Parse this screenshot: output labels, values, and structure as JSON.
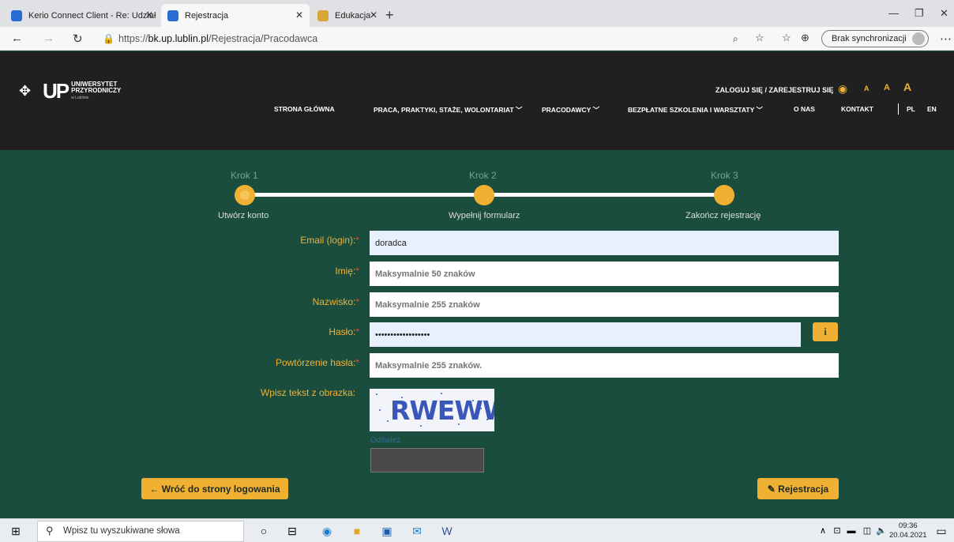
{
  "browser": {
    "tabs": [
      {
        "label": "Kerio Connect Client - Re: Udział",
        "color": "#2a6bd1"
      },
      {
        "label": "Rejestracja",
        "color": "#2a6bd1"
      },
      {
        "label": "Edukacja",
        "color": "#d9a63a"
      }
    ],
    "url_prefix": "https://",
    "url_domain": "bk.up.lublin.pl",
    "url_path": "/Rejestracja/Pracodawca",
    "sync_label": "Brak synchronizacji"
  },
  "site": {
    "logo_mark": "UP",
    "logo_line1": "UNIWERSYTET",
    "logo_line2": "PRZYRODNICZY",
    "logo_line3": "w Lublinie",
    "login_link": "ZALOGUJ SIĘ / ZAREJESTRUJ SIĘ",
    "font_sizes": [
      "A",
      "A",
      "A"
    ],
    "menu": [
      "STRONA GŁÓWNA",
      "PRACA, PRAKTYKI, STAŻE, WOLONTARIAT",
      "PRACODAWCY",
      "BEZPŁATNE SZKOLENIA I WARSZTATY",
      "O NAS",
      "KONTAKT"
    ],
    "lang_pl": "PL",
    "lang_en": "EN"
  },
  "steps": [
    {
      "title": "Krok 1",
      "subtitle": "Utwórz konto"
    },
    {
      "title": "Krok 2",
      "subtitle": "Wypełnij formularz"
    },
    {
      "title": "Krok 3",
      "subtitle": "Zakończ rejestrację"
    }
  ],
  "form": {
    "email": {
      "label": "Email (login):",
      "value": "doradca"
    },
    "first_name": {
      "label": "Imię:",
      "placeholder": "Maksymalnie 50 znaków"
    },
    "last_name": {
      "label": "Nazwisko:",
      "placeholder": "Maksymalnie 255 znaków"
    },
    "password": {
      "label": "Hasło:",
      "value": "••••••••••••••••••"
    },
    "password_repeat": {
      "label": "Powtórzenie hasła:",
      "placeholder": "Maksymalnie 255 znaków."
    },
    "captcha": {
      "label": "Wpisz tekst z obrazka:",
      "code": "RWEWW",
      "refresh": "Odśwież"
    },
    "required_mark": "*",
    "info_icon": "i"
  },
  "buttons": {
    "back": "← Wróć do strony logowania",
    "register": "✎ Rejestracja"
  },
  "taskbar": {
    "search_placeholder": "Wpisz tu wyszukiwane słowa",
    "time": "09:36",
    "date": "20.04.2021"
  }
}
